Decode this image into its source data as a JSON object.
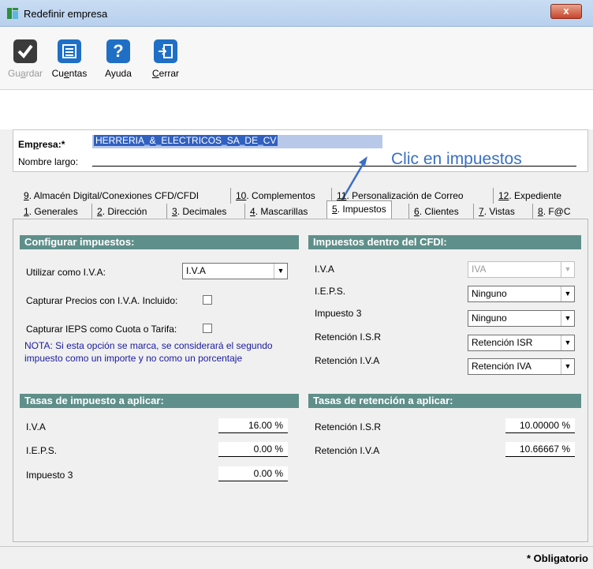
{
  "window": {
    "title": "Redefinir empresa",
    "close_glyph": "x"
  },
  "toolbar": {
    "guardar": {
      "pre": "Gu",
      "u": "a",
      "post": "rdar"
    },
    "cuentas": {
      "pre": "Cu",
      "u": "e",
      "post": "ntas"
    },
    "ayuda": "Ayuda",
    "cerrar": {
      "u": "C",
      "post": "errar"
    }
  },
  "empresa": {
    "label_pre": "Em",
    "label_u": "p",
    "label_post": "resa:*",
    "value": "HERRERIA_&_ELECTRICOS_SA_DE_CV",
    "nombre_largo_label": "Nombre largo:",
    "nombre_largo_value": ""
  },
  "annotation": "Clic en impuestos",
  "tabs_row1": [
    {
      "num": "9",
      "label": ". Almacén Digital/Conexiones CFD/CFDI"
    },
    {
      "num": "10",
      "label": ". Complementos"
    },
    {
      "num": "11",
      "label": ". Personalización de Correo"
    },
    {
      "num": "12",
      "label": ". Expediente"
    }
  ],
  "tabs_row2": [
    {
      "num": "1",
      "label": ". Generales"
    },
    {
      "num": "2",
      "label": ". Dirección"
    },
    {
      "num": "3",
      "label": ". Decimales"
    },
    {
      "num": "4",
      "label": ". Mascarillas"
    },
    {
      "num": "5",
      "label": ". Impuestos"
    },
    {
      "num": "6",
      "label": ". Clientes"
    },
    {
      "num": "7",
      "label": ". Vistas"
    },
    {
      "num": "8",
      "label": ". F@C"
    }
  ],
  "configurar": {
    "header": "Configurar impuestos:",
    "utilizar_iva_label": "Utilizar como I.V.A:",
    "utilizar_iva_value": "I.V.A",
    "capturar_precios_label": "Capturar Precios con I.V.A. Incluido:",
    "capturar_ieps_label": "Capturar IEPS como Cuota o Tarifa:",
    "nota": "NOTA:  Si esta opción se marca, se considerará el segundo impuesto como un importe y no como un porcentaje"
  },
  "cfdi": {
    "header": "Impuestos dentro del CFDI:",
    "rows": [
      {
        "label": "I.V.A",
        "value": "IVA"
      },
      {
        "label": "I.E.P.S.",
        "value": "Ninguno"
      },
      {
        "label": "Impuesto 3",
        "value": "Ninguno"
      },
      {
        "label": "Retención I.S.R",
        "value": "Retención ISR"
      },
      {
        "label": "Retención I.V.A",
        "value": "Retención IVA"
      }
    ]
  },
  "tasas_impuesto": {
    "header": "Tasas de impuesto a aplicar:",
    "rows": [
      {
        "label": "I.V.A",
        "value": "16.00 %"
      },
      {
        "label": "I.E.P.S.",
        "value": "0.00 %"
      },
      {
        "label": "Impuesto 3",
        "value": "0.00 %"
      }
    ]
  },
  "tasas_retencion": {
    "header": "Tasas de retención a aplicar:",
    "rows": [
      {
        "label": "Retención I.S.R",
        "value": "10.00000 %"
      },
      {
        "label": "Retención I.V.A",
        "value": "10.66667 %"
      }
    ]
  },
  "footer": {
    "obligatorio": "* Obligatorio"
  },
  "colors": {
    "section_header": "#5f8f8a",
    "annotation": "#3a6fc4",
    "toolbar_icon": "#1f6fc6"
  }
}
